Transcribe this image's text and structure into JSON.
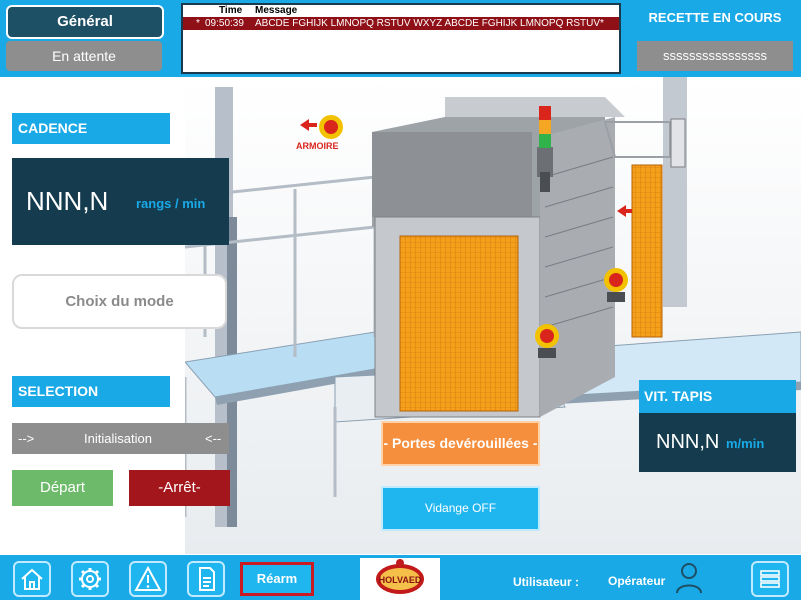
{
  "header": {
    "tab_general": "Général",
    "tab_attente": "En attente",
    "messages": {
      "col_time": "Time",
      "col_message": "Message",
      "rows": [
        {
          "flag": "*",
          "time": "09:50:39",
          "text": "ABCDE FGHIJK LMNOPQ RSTUV WXYZ ABCDE FGHIJK LMNOPQ RSTUV*"
        }
      ]
    },
    "recette_title": "RECETTE EN COURS",
    "recette_name": "ssssssssssssssss"
  },
  "left": {
    "cadence_label": "CADENCE",
    "cadence_value": "NNN,N",
    "cadence_unit": "rangs / min",
    "mode_button": "Choix du mode",
    "selection_label": "SELECTION",
    "init_left": "-->",
    "init_text": "Initialisation",
    "init_right": "<--",
    "depart": "Départ",
    "arret": "-Arrêt-"
  },
  "scene": {
    "armoire_label": "ARMOIRE",
    "tower_colors": [
      "#d9251c",
      "#f5a623",
      "#2fb34a"
    ],
    "grid_color": "#f5a01a",
    "estop_color": "#d9251c"
  },
  "center": {
    "portes_button": "- Portes devérouillées -",
    "vidange_button": "Vidange OFF"
  },
  "right": {
    "vit_label": "VIT. TAPIS",
    "vit_value": "NNN,N",
    "vit_unit": "m/min"
  },
  "footer": {
    "icons": [
      "home-icon",
      "gear-icon",
      "warning-icon",
      "document-icon"
    ],
    "rearm": "Réarm",
    "logo_text": "HOLVAED",
    "user_label": "Utilisateur :",
    "user_name": "Opérateur",
    "menu_icon": "menu-icon"
  },
  "colors": {
    "accent": "#19a9e6",
    "dark_panel": "#153c4e",
    "alarm_red": "#8f1117"
  }
}
